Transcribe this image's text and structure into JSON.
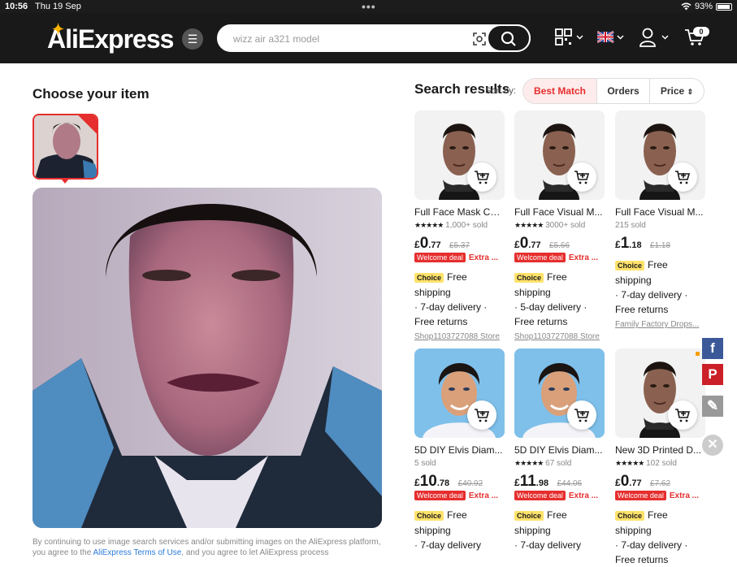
{
  "status_bar": {
    "time": "10:56",
    "date": "Thu 19 Sep",
    "battery": "93%",
    "battery_level": 0.93
  },
  "header": {
    "logo": "AliExpress",
    "search": {
      "value": "",
      "placeholder": "wizz air a321 model"
    },
    "cart_count": "0",
    "colors": {
      "header_bg": "#191919",
      "accent": "#e62e2e"
    }
  },
  "left": {
    "title": "Choose your item",
    "terms_prefix": "By continuing to use image search services and/or submitting images on the AliExpress platform, you agree to the",
    "terms_link": "AliExpress Terms of Use",
    "terms_suffix": ", and you agree to let AliExpress process"
  },
  "results": {
    "title": "Search results",
    "sort_by_label": "Sort by:",
    "sort_options": [
      "Best Match",
      "Orders",
      "Price"
    ],
    "products": [
      {
        "title": "Full Face Mask Cel...",
        "stars": "★★★★★",
        "sold": "1,000+ sold",
        "currency": "£",
        "price_int": "0",
        "price_dec": ".77",
        "old_price": "£5.37",
        "deal_badge": "Welcome deal",
        "deal_extra": "Extra ...",
        "choice": "Choice",
        "shipping": "Free shipping",
        "delivery": "· 7-day delivery ·",
        "returns": "Free returns",
        "store": "Shop1103727088 Store",
        "image": "mask"
      },
      {
        "title": "Full Face Visual M...",
        "stars": "★★★★★",
        "sold": "3000+ sold",
        "currency": "£",
        "price_int": "0",
        "price_dec": ".77",
        "old_price": "£5.66",
        "deal_badge": "Welcome deal",
        "deal_extra": "Extra ...",
        "choice": "Choice",
        "shipping": "Free shipping",
        "delivery": "· 5-day delivery ·",
        "returns": "Free returns",
        "store": "Shop1103727088 Store",
        "image": "mask"
      },
      {
        "title": "Full Face Visual M...",
        "stars": "",
        "sold": "215 sold",
        "currency": "£",
        "price_int": "1",
        "price_dec": ".18",
        "old_price": "£1.18",
        "deal_badge": "",
        "deal_extra": "",
        "choice": "Choice",
        "shipping": "Free shipping",
        "delivery": "· 7-day delivery ·",
        "returns": "Free returns",
        "store": "Family Factory Drops...",
        "image": "mask"
      },
      {
        "title": "5D DIY Elvis Diam...",
        "stars": "",
        "sold": "5 sold",
        "currency": "£",
        "price_int": "10",
        "price_dec": ".78",
        "old_price": "£40.92",
        "deal_badge": "Welcome deal",
        "deal_extra": "Extra ...",
        "choice": "Choice",
        "shipping": "Free shipping",
        "delivery": "· 7-day delivery",
        "returns": "",
        "store": "",
        "image": "elvis"
      },
      {
        "title": "5D DIY Elvis Diam...",
        "stars": "★★★★★",
        "sold": "67 sold",
        "currency": "£",
        "price_int": "11",
        "price_dec": ".98",
        "old_price": "£44.06",
        "deal_badge": "Welcome deal",
        "deal_extra": "Extra ...",
        "choice": "Choice",
        "shipping": "Free shipping",
        "delivery": "· 7-day delivery",
        "returns": "",
        "store": "",
        "image": "elvis"
      },
      {
        "title": "New 3D Printed D...",
        "stars": "★★★★★",
        "sold": "102 sold",
        "currency": "£",
        "price_int": "0",
        "price_dec": ".77",
        "old_price": "£7.62",
        "deal_badge": "Welcome deal",
        "deal_extra": "Extra ...",
        "choice": "Choice",
        "shipping": "Free shipping",
        "delivery": "· 7-day delivery ·",
        "returns": "Free returns",
        "store": "",
        "image": "mask"
      }
    ]
  },
  "social": {
    "facebook": "f",
    "pinterest": "P",
    "edit": "✎",
    "close": "✕"
  }
}
